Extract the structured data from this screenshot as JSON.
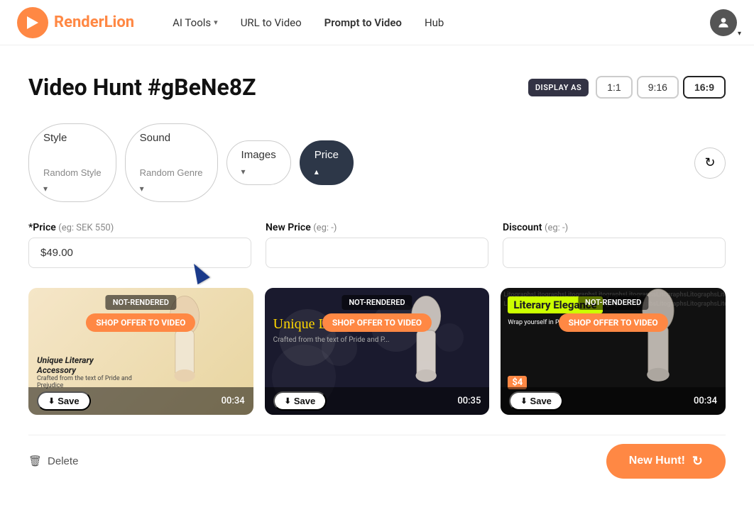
{
  "nav": {
    "logo_text_render": "Render",
    "logo_text_lion": "Lion",
    "links": [
      {
        "label": "AI Tools",
        "has_dropdown": true
      },
      {
        "label": "URL to Video",
        "has_dropdown": false
      },
      {
        "label": "Prompt to Video",
        "has_dropdown": false
      },
      {
        "label": "Hub",
        "has_dropdown": false
      }
    ]
  },
  "page": {
    "title": "Video Hunt #gBeNe8Z",
    "display_as_label": "DISPLAY AS",
    "ratios": [
      "1:1",
      "9:16",
      "16:9"
    ],
    "active_ratio": "16:9"
  },
  "toolbar": {
    "style_label": "Style",
    "style_value": "Random Style",
    "sound_label": "Sound",
    "sound_value": "Random Genre",
    "images_label": "Images",
    "price_label": "Price",
    "refresh_tooltip": "Refresh"
  },
  "form": {
    "price_label": "*Price",
    "price_hint": "(eg: SEK 550)",
    "price_value": "$49.00",
    "new_price_label": "New Price",
    "new_price_hint": "(eg: -)",
    "new_price_value": "",
    "discount_label": "Discount",
    "discount_hint": "(eg: -)",
    "discount_value": ""
  },
  "videos": [
    {
      "id": 1,
      "not_rendered": "NOT-RENDERED",
      "shop_cta": "SHOP OFFER TO VIDEO",
      "title": "Unique Literary Accessory",
      "subtitle": "Crafted from the text of Pride and Prejudice",
      "save_label": "Save",
      "duration": "00:34",
      "style": "warm"
    },
    {
      "id": 2,
      "not_rendered": "NOT-RENDERED",
      "shop_cta": "SHOP OFFER TO VIDEO",
      "script_text": "Unique Literary Accessory",
      "subtitle": "Crafted from the text of Pride and P...",
      "save_label": "Save",
      "duration": "00:35",
      "style": "bokeh"
    },
    {
      "id": 3,
      "not_rendered": "NOT-RENDERED",
      "shop_cta": "SHOP OFFER TO VIDEO",
      "title": "Literary Elegance",
      "subtitle": "Wrap yourself in Pride and P...",
      "price": "$4",
      "save_label": "Save",
      "duration": "00:34",
      "style": "text"
    }
  ],
  "bottom": {
    "delete_label": "Delete",
    "new_hunt_label": "New Hunt!"
  }
}
